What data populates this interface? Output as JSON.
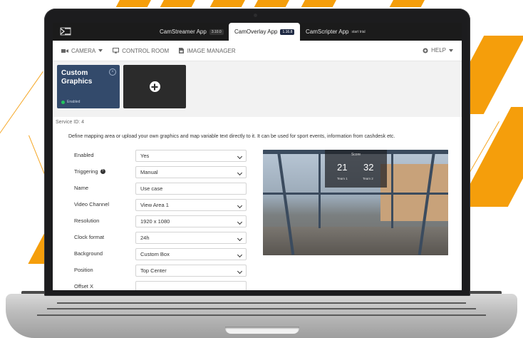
{
  "app_bar": {
    "tabs": [
      {
        "label": "CamStreamer App",
        "version": "3.10.0"
      },
      {
        "label": "CamOverlay App",
        "version": "1.16.8"
      },
      {
        "label": "CamScripter App",
        "extra": "start trial"
      }
    ]
  },
  "nav": {
    "camera": "CAMERA",
    "control_room": "CONTROL ROOM",
    "image_manager": "IMAGE MANAGER",
    "help": "HELP"
  },
  "cards": {
    "custom_graphics": {
      "title": "Custom Graphics",
      "status": "Enabled"
    }
  },
  "service": {
    "id_label": "Service ID: 4",
    "description": "Define mapping area or upload your own graphics and map variable text directly to it. It can be used for sport events, information from cashdesk etc."
  },
  "form": {
    "rows": [
      {
        "label": "Enabled",
        "value": "Yes",
        "type": "select"
      },
      {
        "label": "Triggering",
        "value": "Manual",
        "type": "select",
        "help": true
      },
      {
        "label": "Name",
        "value": "Use case",
        "type": "input"
      },
      {
        "label": "Video Channel",
        "value": "View Area 1",
        "type": "select"
      },
      {
        "label": "Resolution",
        "value": "1920 x 1080",
        "type": "select"
      },
      {
        "label": "Clock format",
        "value": "24h",
        "type": "select"
      },
      {
        "label": "Background",
        "value": "Custom Box",
        "type": "select"
      },
      {
        "label": "Position",
        "value": "Top Center",
        "type": "select"
      },
      {
        "label": "Offset X",
        "value": "",
        "type": "input"
      }
    ]
  },
  "preview": {
    "scoreboard": {
      "title": "Score",
      "score_left": "21",
      "score_right": "32",
      "team_left": "Team 1",
      "team_right": "Team 2"
    }
  },
  "colors": {
    "accent_orange": "#f59e0b",
    "app_bar_bg": "#1b1b1b",
    "card_active_bg": "#334a6b",
    "status_green": "#22c55e"
  }
}
